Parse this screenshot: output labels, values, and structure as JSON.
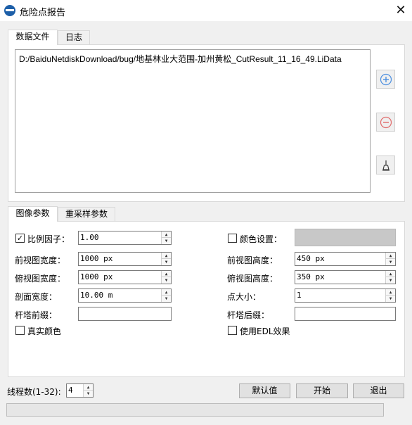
{
  "window": {
    "title": "危险点报告"
  },
  "top_tabs": [
    {
      "label": "数据文件",
      "active": true
    },
    {
      "label": "日志",
      "active": false
    }
  ],
  "files": [
    "D:/BaiduNetdiskDownload/bug/地基林业大范围-加州黄松_CutResult_11_16_49.LiData"
  ],
  "param_tabs": [
    {
      "label": "图像参数",
      "active": true
    },
    {
      "label": "重采样参数",
      "active": false
    }
  ],
  "params": {
    "scale_factor": {
      "label": "比例因子：",
      "value": "1.00",
      "checked": true
    },
    "color_setting": {
      "label": "颜色设置：",
      "checked": false,
      "color": "#c8c8c8"
    },
    "front_width": {
      "label": "前视图宽度：",
      "value": "1000 px"
    },
    "front_height": {
      "label": "前视图高度：",
      "value": "450 px"
    },
    "top_width": {
      "label": "俯视图宽度：",
      "value": "1000 px"
    },
    "top_height": {
      "label": "俯视图高度：",
      "value": "350 px"
    },
    "section_width": {
      "label": "剖面宽度：",
      "value": "10.00 m"
    },
    "point_size": {
      "label": "点大小：",
      "value": "1"
    },
    "tower_prefix": {
      "label": "杆塔前缀：",
      "value": ""
    },
    "tower_suffix": {
      "label": "杆塔后缀：",
      "value": ""
    },
    "true_color": {
      "label": "真实颜色",
      "checked": false
    },
    "edl": {
      "label": "使用EDL效果",
      "checked": false
    }
  },
  "footer": {
    "threads_label": "线程数(1-32):",
    "threads_value": "4",
    "default_button": "默认值",
    "start_button": "开始",
    "exit_button": "退出",
    "progress": 0
  }
}
